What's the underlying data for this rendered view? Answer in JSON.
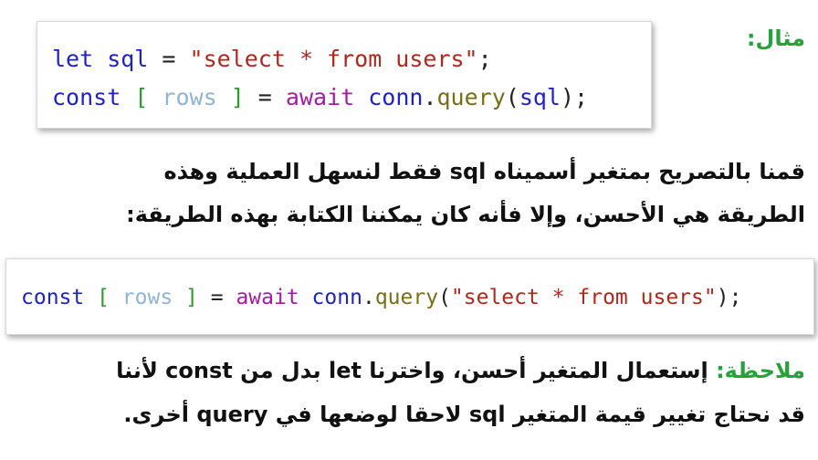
{
  "example_label": "مثال:",
  "code1": {
    "line1": [
      "let",
      " sql",
      " = ",
      "\"select * from users\"",
      ";"
    ],
    "line2": [
      "const",
      " [",
      " rows",
      " ]",
      " = ",
      "await",
      " conn",
      ".",
      "query",
      "(",
      "sql",
      ");"
    ]
  },
  "paragraph": {
    "line1": "قمنا بالتصريح بمتغير أسميناه sql فقط لنسهل العملية وهذه",
    "line2": "الطريقة هي الأحسن، وإلا فأنه كان يمكننا الكتابة بهذه الطريقة:"
  },
  "code2": {
    "line": [
      "const",
      " [",
      " rows",
      " ]",
      " = ",
      "await",
      " conn",
      ".",
      "query",
      "(",
      "\"select * from users\"",
      ");"
    ]
  },
  "note": {
    "label": "ملاحظة:",
    "line1": " إستعمال المتغير أحسن، واخترنا let بدل من const  لأننا",
    "line2": "قد نحتاج تغيير قيمة المتغير sql لاحقا لوضعها في query أخرى."
  }
}
